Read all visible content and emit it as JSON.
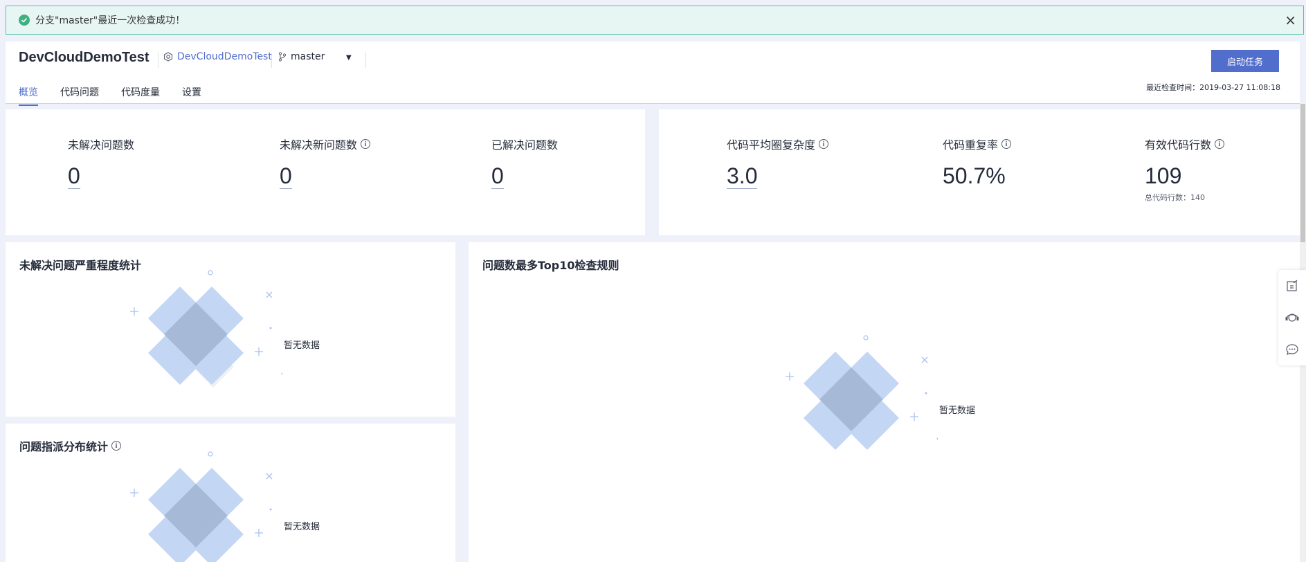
{
  "banner": {
    "message": "分支\"master\"最近一次检查成功！",
    "close": "×"
  },
  "header": {
    "project_name": "DevCloudDemoTest",
    "repo_name": "DevCloudDemoTest",
    "branch": "master",
    "start_button": "启动任务",
    "last_check": "最近检查时间：2019-03-27 11:08:18",
    "tabs": [
      "概览",
      "代码问题",
      "代码度量",
      "设置"
    ]
  },
  "issues_panel": {
    "metrics": [
      {
        "label": "未解决问题数",
        "value": "0"
      },
      {
        "label": "未解决新问题数",
        "value": "0"
      },
      {
        "label": "已解决问题数",
        "value": "0"
      }
    ]
  },
  "code_panel": {
    "metrics": [
      {
        "label": "代码平均圈复杂度",
        "value": "3.0"
      },
      {
        "label": "代码重复率",
        "value": "50.7%"
      },
      {
        "label": "有效代码行数",
        "value": "109",
        "sub": "总代码行数：140"
      }
    ]
  },
  "cards": {
    "severity_title": "未解决问题严重程度统计",
    "assign_title": "问题指派分布统计",
    "top10_title": "问题数最多Top10检查规则",
    "empty_text": "暂无数据"
  },
  "info_glyph": "i",
  "colors": {
    "accent": "#526ecc",
    "success_bg": "#e8f6f3",
    "success_border": "#55c2a5"
  }
}
